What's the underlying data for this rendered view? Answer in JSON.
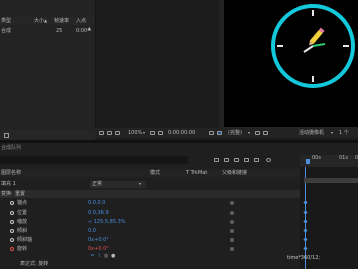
{
  "project": {
    "columns": {
      "type": "类型",
      "size": "大小",
      "fps": "帧速率",
      "in": "入点"
    },
    "row": {
      "type": "合成",
      "fps": "25",
      "in": "0:00"
    }
  },
  "viewer": {
    "zoom": "100%",
    "time": "0:00:00:00",
    "mode": "(完整)",
    "camera": "活动摄像机",
    "views": "1 个"
  },
  "timeline": {
    "tab": "合成队列",
    "col_layer": "图层名称",
    "col_mode": "模式",
    "col_trkmat": "T TrkMat",
    "col_parent": "父级和链接",
    "ruler": [
      "00s",
      "01s",
      "02s"
    ],
    "layer": {
      "name": "填充 1",
      "mode": "正常"
    },
    "transform": "变换",
    "transform_reset": "重置",
    "props": [
      {
        "name": "锚点",
        "value": "0.0,0.0"
      },
      {
        "name": "位置",
        "value": "0.0,36.9"
      },
      {
        "name": "缩放",
        "value": "∞ 125.5,85.3%"
      },
      {
        "name": "倾斜",
        "value": "0.0"
      },
      {
        "name": "倾斜轴",
        "value": "0x+0.0°"
      },
      {
        "name": "旋转",
        "value": "0x+0.0°"
      }
    ],
    "expression_label": "表达式: 旋转",
    "expression_code": "time*360/12;"
  },
  "clock": {
    "ring_color": "#14c8dc",
    "marker_color": "#e6e6e6",
    "minute_hand": "#2ecc71",
    "pencil_color": "#f2d23c"
  }
}
